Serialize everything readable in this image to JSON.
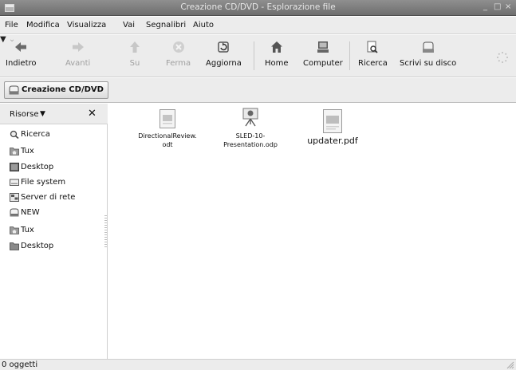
{
  "window": {
    "title": "Creazione CD/DVD - Esplorazione file",
    "minimize": "_",
    "maximize": "□",
    "close": "×"
  },
  "menu": [
    "File",
    "Modifica",
    "Visualizza",
    "Vai",
    "Segnalibri",
    "Aiuto"
  ],
  "toolbar": {
    "back": "Indietro",
    "forward": "Avanti",
    "up": "Su",
    "stop": "Ferma",
    "reload": "Aggiorna",
    "home": "Home",
    "computer": "Computer",
    "search": "Ricerca",
    "burn": "Scrivi su disco"
  },
  "location": {
    "button": "Creazione CD/DVD"
  },
  "sidebar": {
    "header": "Risorse",
    "close": "✕",
    "items": [
      {
        "label": "Ricerca",
        "icon": "search-icon"
      },
      {
        "label": "Tux",
        "icon": "home-folder-icon"
      },
      {
        "label": "Desktop",
        "icon": "desktop-icon"
      },
      {
        "label": "File system",
        "icon": "drive-icon"
      },
      {
        "label": "Server di rete",
        "icon": "network-icon"
      },
      {
        "label": "NEW",
        "icon": "optical-drive-icon"
      },
      {
        "label": "Tux",
        "icon": "home-folder-icon"
      },
      {
        "label": "Desktop",
        "icon": "folder-icon"
      }
    ]
  },
  "files": [
    {
      "line1": "DirectionalReview.",
      "line2": "odt",
      "icon": "document-icon"
    },
    {
      "line1": "SLED-10-",
      "line2": "Presentation.odp",
      "icon": "presentation-icon"
    },
    {
      "line1": "updater.pdf",
      "line2": "",
      "icon": "pdf-icon"
    }
  ],
  "status": {
    "text": "0 oggetti"
  }
}
